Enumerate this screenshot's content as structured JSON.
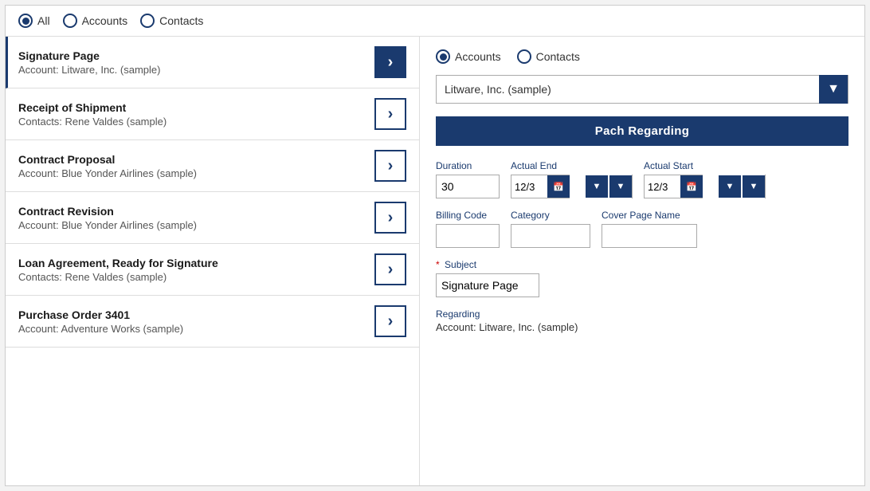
{
  "topbar": {
    "radio_all_label": "All",
    "radio_accounts_label": "Accounts",
    "radio_contacts_label": "Contacts",
    "selected": "all"
  },
  "list": {
    "items": [
      {
        "title": "Signature Page",
        "sub": "Account: Litware, Inc. (sample)",
        "active": true
      },
      {
        "title": "Receipt of Shipment",
        "sub": "Contacts: Rene Valdes (sample)",
        "active": false
      },
      {
        "title": "Contract Proposal",
        "sub": "Account: Blue Yonder Airlines (sample)",
        "active": false
      },
      {
        "title": "Contract Revision",
        "sub": "Account: Blue Yonder Airlines (sample)",
        "active": false
      },
      {
        "title": "Loan Agreement, Ready for Signature",
        "sub": "Contacts: Rene Valdes (sample)",
        "active": false
      },
      {
        "title": "Purchase Order 3401",
        "sub": "Account: Adventure Works (sample)",
        "active": false
      }
    ]
  },
  "rightpanel": {
    "radio_accounts_label": "Accounts",
    "radio_contacts_label": "Contacts",
    "selected": "accounts",
    "dropdown_value": "Litware, Inc. (sample)",
    "pach_button_label": "Pach Regarding",
    "duration_label": "Duration",
    "duration_value": "30",
    "actual_end_label": "Actual End",
    "actual_end_date": "12/3",
    "actual_start_label": "Actual Start",
    "actual_start_date": "12/3",
    "billing_code_label": "Billing Code",
    "billing_code_value": "",
    "category_label": "Category",
    "category_value": "",
    "cover_page_label": "Cover Page Name",
    "cover_page_value": "",
    "subject_label": "Subject",
    "subject_value": "Signature Page",
    "regarding_label": "Regarding",
    "regarding_value": "Account: Litware, Inc. (sample)"
  }
}
